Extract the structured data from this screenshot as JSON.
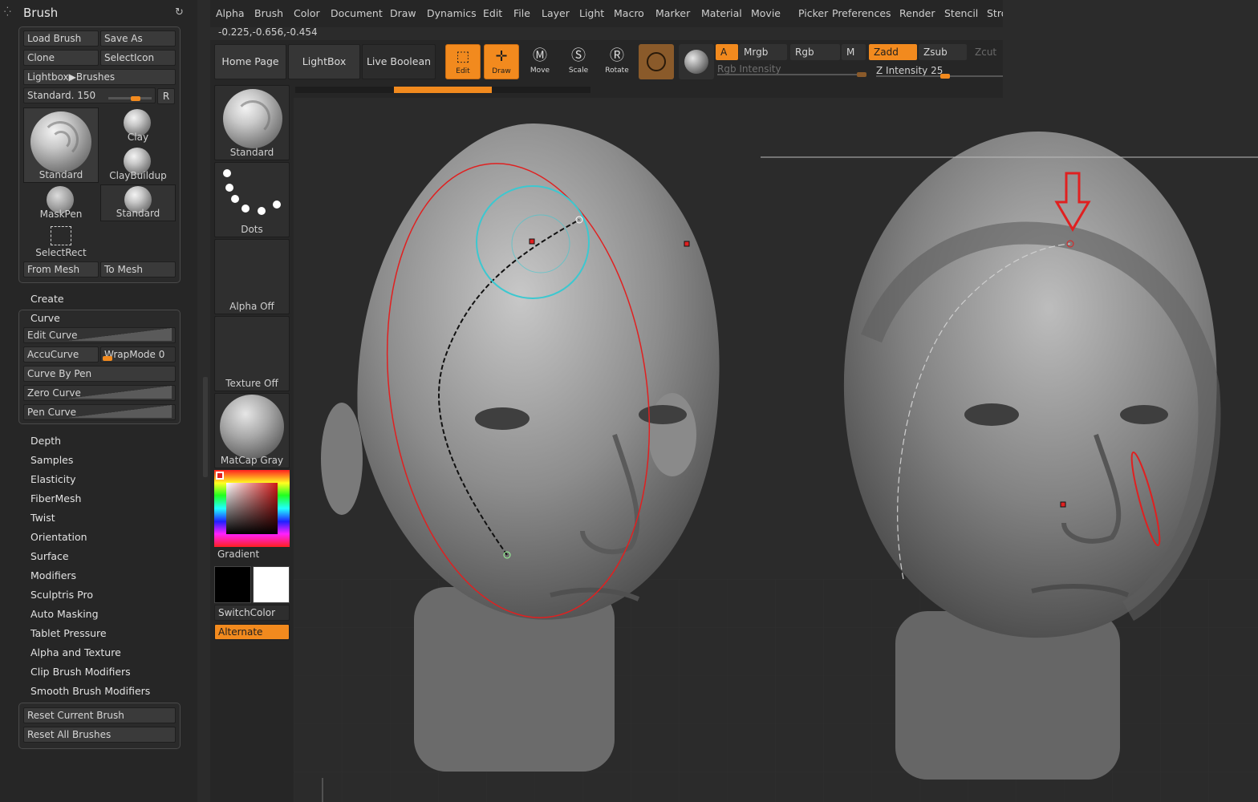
{
  "palette": {
    "title": "Brush",
    "buttons": {
      "load_brush": "Load Brush",
      "save_as": "Save As",
      "clone": "Clone",
      "select_icon": "SelectIcon",
      "lightbox_brushes": "Lightbox▶Brushes",
      "from_mesh": "From Mesh",
      "to_mesh": "To Mesh"
    },
    "current_brush": {
      "label": "Standard.",
      "value": "150",
      "reset": "R",
      "fraction": 0.48
    },
    "brushes": [
      "Standard",
      "Clay",
      "ClayBuildup",
      "MaskPen",
      "Standard",
      "SelectRect"
    ],
    "create_label": "Create",
    "curve": {
      "title": "Curve",
      "edit_curve": "Edit Curve",
      "accucurve": "AccuCurve",
      "wrapmode_label": "WrapMode",
      "wrapmode_value": "0",
      "curve_by_pen": "Curve By Pen",
      "zero_curve": "Zero Curve",
      "pen_curve": "Pen Curve"
    },
    "sections": [
      "Depth",
      "Samples",
      "Elasticity",
      "FiberMesh",
      "Twist",
      "Orientation",
      "Surface",
      "Modifiers",
      "Sculptris Pro",
      "Auto Masking",
      "Tablet Pressure",
      "Alpha and Texture",
      "Clip Brush Modifiers",
      "Smooth Brush Modifiers"
    ],
    "reset_current": "Reset Current Brush",
    "reset_all": "Reset All Brushes"
  },
  "menu": [
    "Alpha",
    "Brush",
    "Color",
    "Document",
    "Draw",
    "Dynamics",
    "Edit",
    "File",
    "Layer",
    "Light",
    "Macro",
    "Marker",
    "Material",
    "Movie",
    "Picker",
    "Preferences",
    "Render",
    "Stencil",
    "Stro"
  ],
  "coords": "-0.225,-0.656,-0.454",
  "toolbar": {
    "home_page": "Home Page",
    "lightbox": "LightBox",
    "live_boolean": "Live Boolean",
    "tools": [
      {
        "name": "Edit",
        "active": true
      },
      {
        "name": "Draw",
        "active": true
      },
      {
        "name": "Move",
        "active": false
      },
      {
        "name": "Scale",
        "active": false
      },
      {
        "name": "Rotate",
        "active": false
      }
    ],
    "a": "A",
    "mrgb": "Mrgb",
    "rgb": "Rgb",
    "m": "M",
    "zadd": "Zadd",
    "zsub": "Zsub",
    "zcut": "Zcut",
    "rgb_intensity": "Rgb Intensity",
    "z_intensity_label": "Z Intensity",
    "z_intensity_value": "25"
  },
  "shelf": {
    "brush": "Standard",
    "stroke": "Dots",
    "alpha": "Alpha Off",
    "texture": "Texture Off",
    "material": "MatCap Gray",
    "gradient": "Gradient",
    "switch_color": "SwitchColor",
    "alternate": "Alternate"
  },
  "colors": {
    "accent": "#f28a1e",
    "curve": "#e02020",
    "brush_ring": "#3cc8d0"
  }
}
